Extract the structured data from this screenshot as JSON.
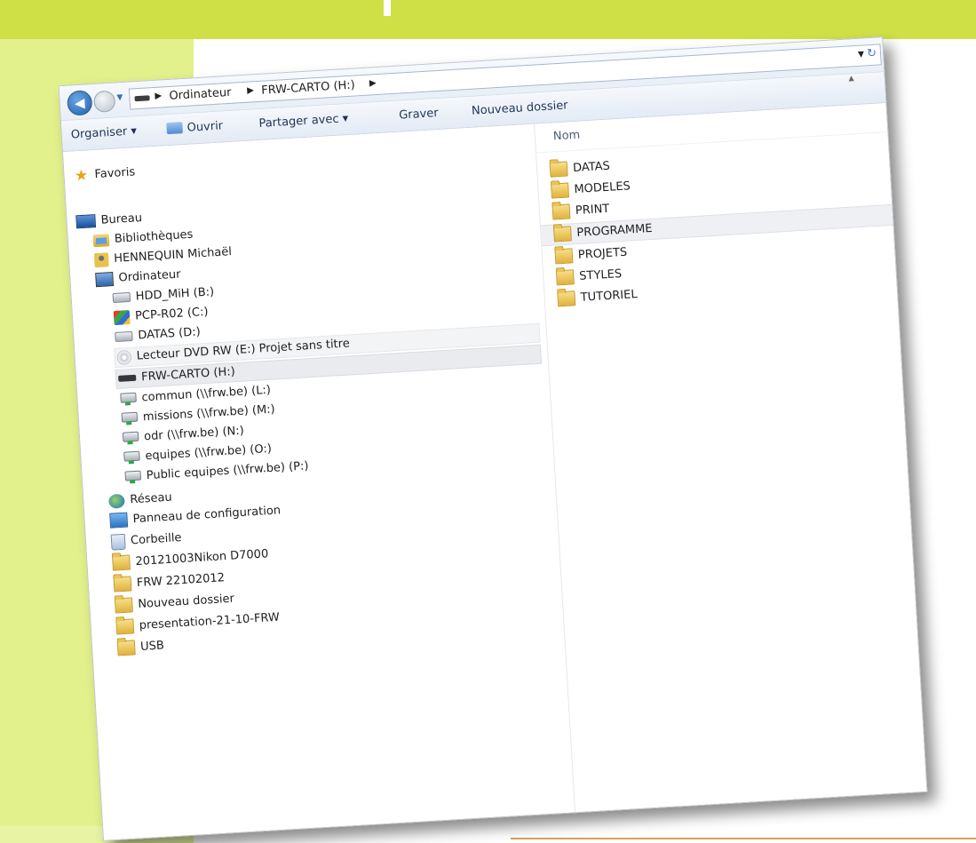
{
  "address": {
    "crumbs": [
      "Ordinateur",
      "FRW-CARTO (H:)"
    ]
  },
  "toolbar": {
    "organize": "Organiser ▾",
    "open": "Ouvrir",
    "share": "Partager avec ▾",
    "burn": "Graver",
    "new_folder": "Nouveau dossier"
  },
  "nav_tree": [
    {
      "label": "Favoris",
      "icon": "star-icon"
    },
    {
      "label": "Bureau",
      "icon": "desktop-icon"
    },
    {
      "label": "Bibliothèques",
      "icon": "libraries-icon"
    },
    {
      "label": "HENNEQUIN Michaël",
      "icon": "user-folder-icon"
    },
    {
      "label": "Ordinateur",
      "icon": "computer-icon"
    },
    {
      "label": "HDD_MiH (B:)",
      "icon": "hard-drive-icon"
    },
    {
      "label": "PCP-R02 (C:)",
      "icon": "system-drive-icon"
    },
    {
      "label": "DATAS (D:)",
      "icon": "hard-drive-icon"
    },
    {
      "label": "Lecteur DVD RW (E:) Projet sans titre",
      "icon": "dvd-icon"
    },
    {
      "label": "FRW-CARTO (H:)",
      "icon": "usb-drive-icon"
    },
    {
      "label": "commun (\\\\frw.be) (L:)",
      "icon": "network-drive-icon"
    },
    {
      "label": "missions (\\\\frw.be) (M:)",
      "icon": "network-drive-icon"
    },
    {
      "label": "odr (\\\\frw.be) (N:)",
      "icon": "network-drive-icon"
    },
    {
      "label": "equipes (\\\\frw.be) (O:)",
      "icon": "network-drive-icon"
    },
    {
      "label": "Public equipes (\\\\frw.be) (P:)",
      "icon": "network-drive-icon"
    },
    {
      "label": "Réseau",
      "icon": "network-globe-icon"
    },
    {
      "label": "Panneau de configuration",
      "icon": "control-panel-icon"
    },
    {
      "label": "Corbeille",
      "icon": "recycle-bin-icon"
    },
    {
      "label": "20121003Nikon D7000",
      "icon": "folder-icon"
    },
    {
      "label": "FRW 22102012",
      "icon": "folder-icon"
    },
    {
      "label": "Nouveau dossier",
      "icon": "folder-icon"
    },
    {
      "label": "presentation-21-10-FRW",
      "icon": "folder-icon"
    },
    {
      "label": "USB",
      "icon": "folder-icon"
    }
  ],
  "file_list": {
    "column_header": "Nom",
    "items": [
      "DATAS",
      "MODELES",
      "PRINT",
      "PROGRAMME",
      "PROJETS",
      "STYLES",
      "TUTORIEL"
    ]
  }
}
